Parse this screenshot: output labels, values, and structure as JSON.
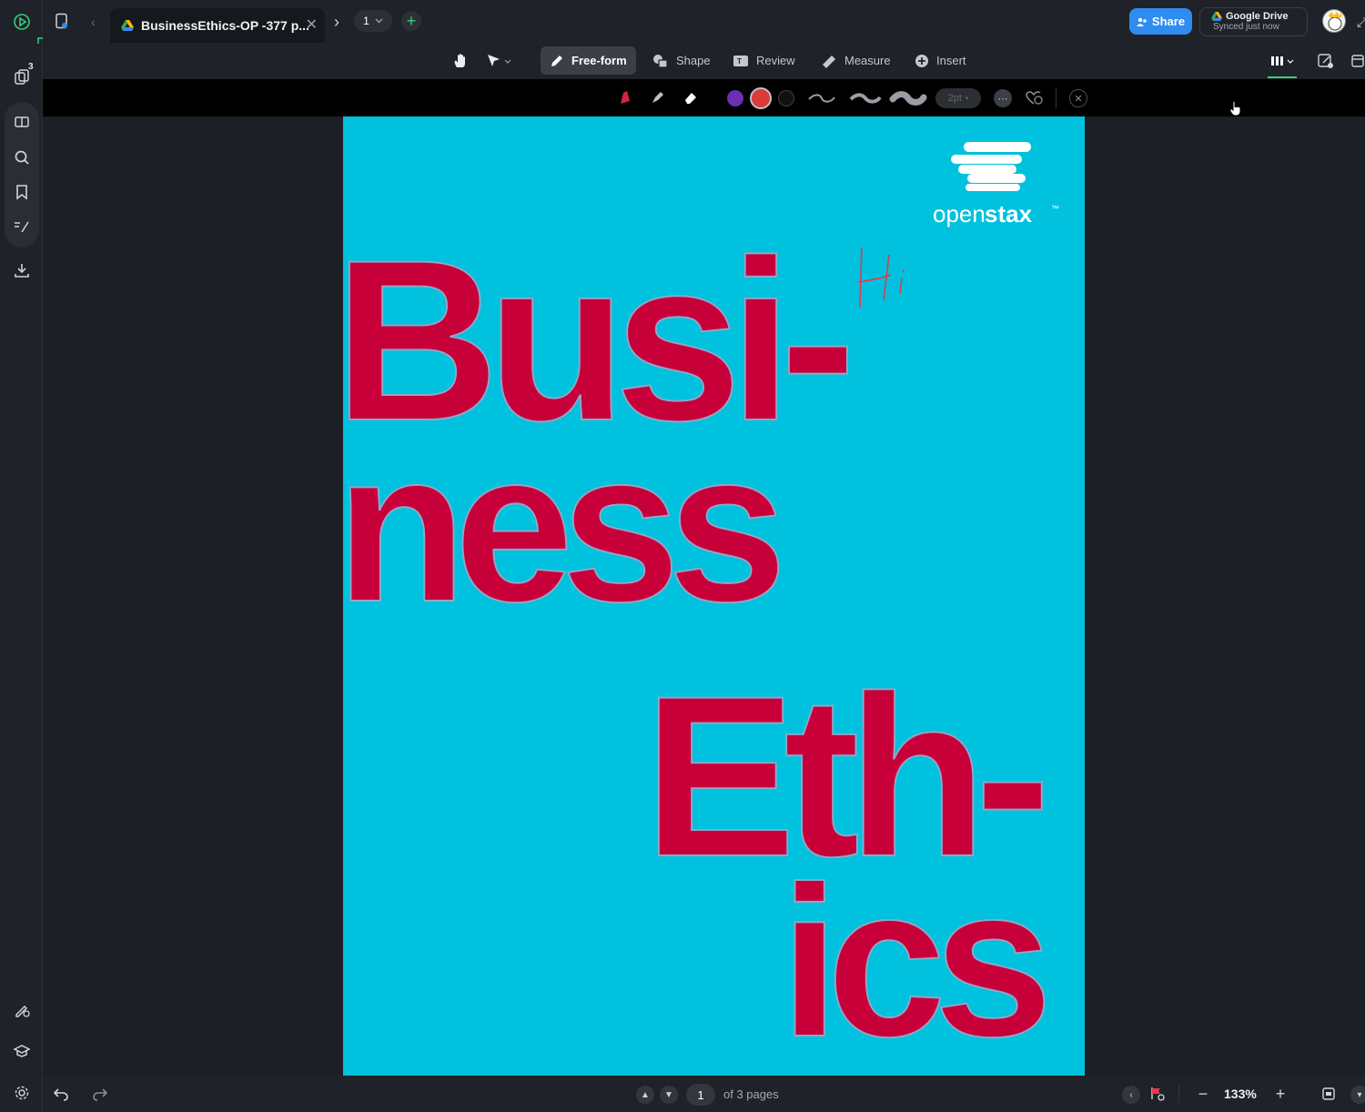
{
  "titlebar": {
    "tab_title": "BusinessEthics-OP -377 p...",
    "page_counter": "1",
    "share_label": "Share",
    "drive_title": "Google Drive",
    "drive_status": "Synced just now"
  },
  "rail": {
    "doc_count_badge": "3"
  },
  "toolbar": {
    "freeform_label": "Free-form",
    "shape_label": "Shape",
    "review_label": "Review",
    "measure_label": "Measure",
    "insert_label": "Insert"
  },
  "subbar": {
    "stroke_size": "2pt",
    "colors": [
      "#6a2fb3",
      "#d93a3a",
      "#111111"
    ]
  },
  "document": {
    "logo_text_light": "open",
    "logo_text_bold": "stax",
    "logo_tm": "™",
    "line1": "Busi-",
    "line2": "ness",
    "line3": "Eth-",
    "line4": "ics",
    "handwriting": "Hi",
    "accent_color": "#c8003a",
    "background_color": "#00c1de"
  },
  "bottombar": {
    "current_page": "1",
    "of_pages": "of 3 pages",
    "zoom": "133%"
  }
}
